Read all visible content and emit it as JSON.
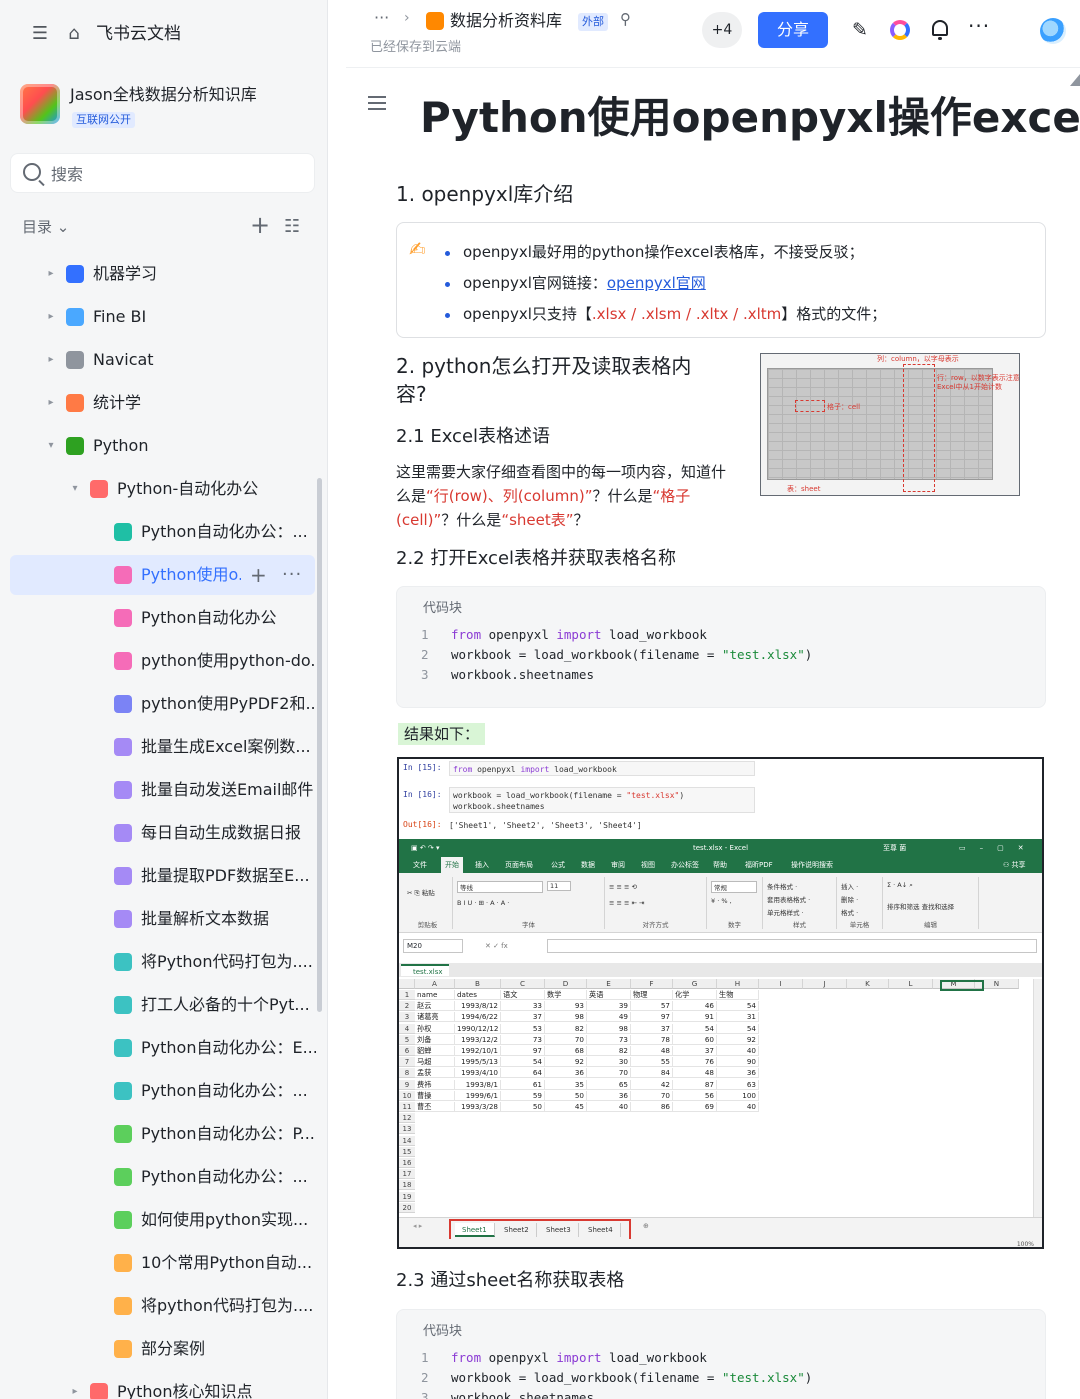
{
  "sidebar": {
    "brand": "飞书云文档",
    "kb_name": "Jason全栈数据分析知识库",
    "kb_badge": "互联网公开",
    "search_placeholder": "搜索",
    "toc_label": "目录 ⌄",
    "items": [
      {
        "label": "机器学习",
        "icon": "robot-icon",
        "color": "#3370ff"
      },
      {
        "label": "Fine BI",
        "icon": "globe-icon",
        "color": "#4aa8ff"
      },
      {
        "label": "Navicat",
        "icon": "gear-icon",
        "color": "#8f959e"
      },
      {
        "label": "统计学",
        "icon": "doc-pen-icon",
        "color": "#ff7a45"
      },
      {
        "label": "Python",
        "icon": "python-icon",
        "color": "#2ea121"
      },
      {
        "label": "Python-自动化办公",
        "icon": "folder-icon",
        "color": "#ff6a6a"
      },
      {
        "label": "Python自动化办公：...",
        "icon": "doc-icon",
        "color": "#1fbfa5"
      },
      {
        "label": "Python使用o...",
        "icon": "doc-icon",
        "color": "#f56cb8"
      },
      {
        "label": "Python自动化办公",
        "icon": "doc-icon",
        "color": "#f56cb8"
      },
      {
        "label": "python使用python-do...",
        "icon": "doc-icon",
        "color": "#f56cb8"
      },
      {
        "label": "python使用PyPDF2和...",
        "icon": "doc-icon",
        "color": "#7b83f5"
      },
      {
        "label": "批量生成Excel案例数...",
        "icon": "doc-icon",
        "color": "#a58af5"
      },
      {
        "label": "批量自动发送Email邮件",
        "icon": "doc-icon",
        "color": "#a58af5"
      },
      {
        "label": "每日自动生成数据日报",
        "icon": "doc-icon",
        "color": "#a58af5"
      },
      {
        "label": "批量提取PDF数据至E...",
        "icon": "doc-icon",
        "color": "#a58af5"
      },
      {
        "label": "批量解析文本数据",
        "icon": "doc-icon",
        "color": "#a58af5"
      },
      {
        "label": "将Python代码打包为....",
        "icon": "doc-icon",
        "color": "#3cc2c2"
      },
      {
        "label": "打工人必备的十个Pyt...",
        "icon": "doc-icon",
        "color": "#3cc2c2"
      },
      {
        "label": "Python自动化办公：E...",
        "icon": "doc-icon",
        "color": "#3cc2c2"
      },
      {
        "label": "Python自动化办公：...",
        "icon": "doc-icon",
        "color": "#3cc2c2"
      },
      {
        "label": "Python自动化办公：P...",
        "icon": "doc-icon",
        "color": "#5ccf5c"
      },
      {
        "label": "Python自动化办公：...",
        "icon": "doc-icon",
        "color": "#5ccf5c"
      },
      {
        "label": "如何使用python实现...",
        "icon": "doc-icon",
        "color": "#5ccf5c"
      },
      {
        "label": "10个常用Python自动...",
        "icon": "doc-icon",
        "color": "#ffb14a"
      },
      {
        "label": "将python代码打包为....",
        "icon": "doc-icon",
        "color": "#ffb14a"
      },
      {
        "label": "部分案例",
        "icon": "doc-icon",
        "color": "#ffb14a"
      },
      {
        "label": "Python核心知识点",
        "icon": "folder-icon",
        "color": "#ff6a6a"
      }
    ]
  },
  "topbar": {
    "more": "···",
    "sep": "›",
    "doc_title": "数据分析资料库",
    "ext_badge": "外部",
    "saved": "已经保存到云端",
    "collab_count": "+4",
    "share_label": "分享",
    "edit_icon": "✎"
  },
  "doc": {
    "title": "Python使用openpyxl操作excel",
    "s1": "1. openpyxl库介绍",
    "callout": {
      "b1": "openpyxl最好用的python操作excel表格库，不接受反驳；",
      "b2_pre": "openpyxl官网链接：",
      "b2_link": "openpyxl官网",
      "b3_pre": "openpyxl只支持【",
      "b3_ext": ".xlsx / .xlsm / .xltx / .xltm",
      "b3_post": "】格式的文件；"
    },
    "s2_line1": "2. python怎么打开及读取表格内",
    "s2_line2": "容?",
    "s21": "2.1 Excel表格述语",
    "p_a": "这里需要大家仔细查看图中的每一项内容，知道什么是",
    "p_b": "“行(row)、列(column)”",
    "p_c": "？什么是",
    "p_d": "“格子(cell)”",
    "p_e": "？什么是",
    "p_f": "“sheet表”",
    "p_g": "？",
    "thumb": {
      "t1": "列：column，以字母表示",
      "t2": "行：row，以数字表示注意Excel中从1开始计数",
      "t3": "格子：cell",
      "t4": "表：sheet"
    },
    "s22": "2.2 打开Excel表格并获取表格名称",
    "code_label": "代码块",
    "code1": {
      "l1_kw1": "from",
      "l1_mid": " openpyxl ",
      "l1_kw2": "import",
      "l1_end": " load_workbook",
      "l2_pre": "workbook = load_workbook(filename = ",
      "l2_str": "\"test.xlsx\"",
      "l2_end": ")",
      "l3": "workbook.sheetnames"
    },
    "result_label": "结果如下：",
    "s23": "2.3 通过sheet名称获取表格",
    "code2_label": "代码块",
    "code2": {
      "l1_kw1": "from",
      "l1_mid": " openpyxl ",
      "l1_kw2": "import",
      "l1_end": " load_workbook",
      "l2_pre": "workbook = load_workbook(filename = ",
      "l2_str": "\"test.xlsx\"",
      "l2_end": ")",
      "l3": "workbook.sheetnames"
    }
  },
  "shot": {
    "in15": "In  [15]:",
    "in15_code": "from openpyxl import load_workbook",
    "in16": "In  [16]:",
    "in16_code1": "workbook = load_workbook(filename = \"test.xlsx\")",
    "in16_code2": "workbook.sheetnames",
    "out16": "Out[16]:",
    "out16_text": "['Sheet1', 'Sheet2', 'Sheet3', 'Sheet4']",
    "xl_title": "test.xlsx  -  Excel",
    "xl_user": "至尊 菌",
    "ribbon_tabs": [
      "文件",
      "开始",
      "插入",
      "页面布局",
      "公式",
      "数据",
      "审阅",
      "视图",
      "办公标签",
      "帮助",
      "福昕PDF",
      "操作说明搜索"
    ],
    "share": "共享",
    "groups": [
      "剪贴板",
      "字体",
      "对齐方式",
      "数字",
      "样式",
      "单元格",
      "编辑"
    ],
    "font_name": "等线",
    "font_size": "11",
    "num_fmt": "常规",
    "style_lines": [
      "条件格式 ·",
      "套用表格格式 ·",
      "单元格样式 ·"
    ],
    "cell_lines": [
      "插入 ·",
      "删除 ·",
      "格式 ·"
    ],
    "edit_line": "排序和筛选 查找和选择",
    "namebox": "M20",
    "file_tab": "test.xlsx",
    "columns": [
      "A",
      "B",
      "C",
      "D",
      "E",
      "F",
      "G",
      "H",
      "I",
      "J",
      "K",
      "L",
      "M",
      "N"
    ],
    "headers": [
      "name",
      "dates",
      "语文",
      "数学",
      "英语",
      "物理",
      "化学",
      "生物"
    ],
    "rows": [
      [
        "赵云",
        "1993/8/12",
        "33",
        "93",
        "39",
        "57",
        "46",
        "54"
      ],
      [
        "诸葛亮",
        "1994/6/22",
        "37",
        "98",
        "49",
        "97",
        "91",
        "31"
      ],
      [
        "孙权",
        "1990/12/12",
        "53",
        "82",
        "98",
        "37",
        "54",
        "54"
      ],
      [
        "刘备",
        "1993/12/2",
        "73",
        "70",
        "73",
        "78",
        "60",
        "92"
      ],
      [
        "貂蝉",
        "1992/10/1",
        "97",
        "68",
        "82",
        "48",
        "37",
        "40"
      ],
      [
        "马超",
        "1995/5/13",
        "54",
        "92",
        "30",
        "55",
        "76",
        "90"
      ],
      [
        "孟获",
        "1993/4/10",
        "64",
        "36",
        "70",
        "84",
        "48",
        "36"
      ],
      [
        "费祎",
        "1993/8/1",
        "61",
        "35",
        "65",
        "42",
        "87",
        "63"
      ],
      [
        "曹操",
        "1999/6/1",
        "59",
        "50",
        "36",
        "70",
        "56",
        "100"
      ],
      [
        "曹丕",
        "1993/3/28",
        "50",
        "45",
        "40",
        "86",
        "69",
        "40"
      ]
    ],
    "row_numbers": [
      "1",
      "2",
      "3",
      "4",
      "5",
      "6",
      "7",
      "8",
      "9",
      "10",
      "11",
      "12",
      "13",
      "14",
      "15",
      "16",
      "17",
      "18",
      "19",
      "20"
    ],
    "sheets": [
      "Sheet1",
      "Sheet2",
      "Sheet3",
      "Sheet4"
    ],
    "zoom": "100%"
  }
}
